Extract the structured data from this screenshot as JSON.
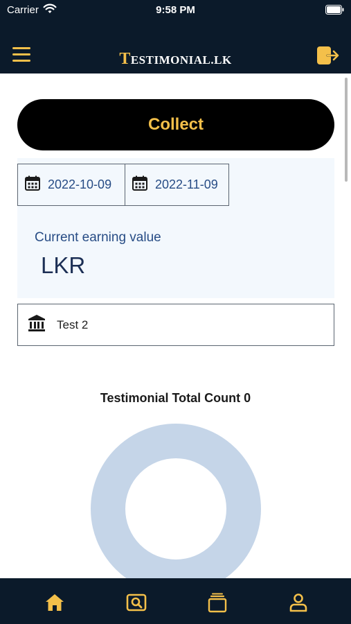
{
  "status_bar": {
    "carrier": "Carrier",
    "time": "9:58 PM"
  },
  "header": {
    "logo_initial": "T",
    "logo_rest": "ESTIMONIAL.LK",
    "icons": [
      "menu-icon",
      "logout-icon"
    ]
  },
  "actions": {
    "collect_label": "Collect"
  },
  "date_range": {
    "from": "2022-10-09",
    "to": "2022-11-09"
  },
  "earning": {
    "label": "Current earning value",
    "value": "LKR"
  },
  "bank": {
    "name": "Test 2"
  },
  "chart": {
    "title": "Testimonial Total Count 0"
  },
  "chart_data": {
    "type": "pie",
    "title": "Testimonial Total Count 0",
    "categories": [],
    "values": []
  },
  "bottom_nav": {
    "items": [
      "home-icon",
      "search-icon",
      "cards-icon",
      "profile-icon"
    ]
  },
  "colors": {
    "header_bg": "#0b1a2a",
    "accent": "#f4c04a",
    "panel_bg": "#f3f8fd",
    "label_blue": "#274c85",
    "donut_empty": "#c5d5e8"
  }
}
